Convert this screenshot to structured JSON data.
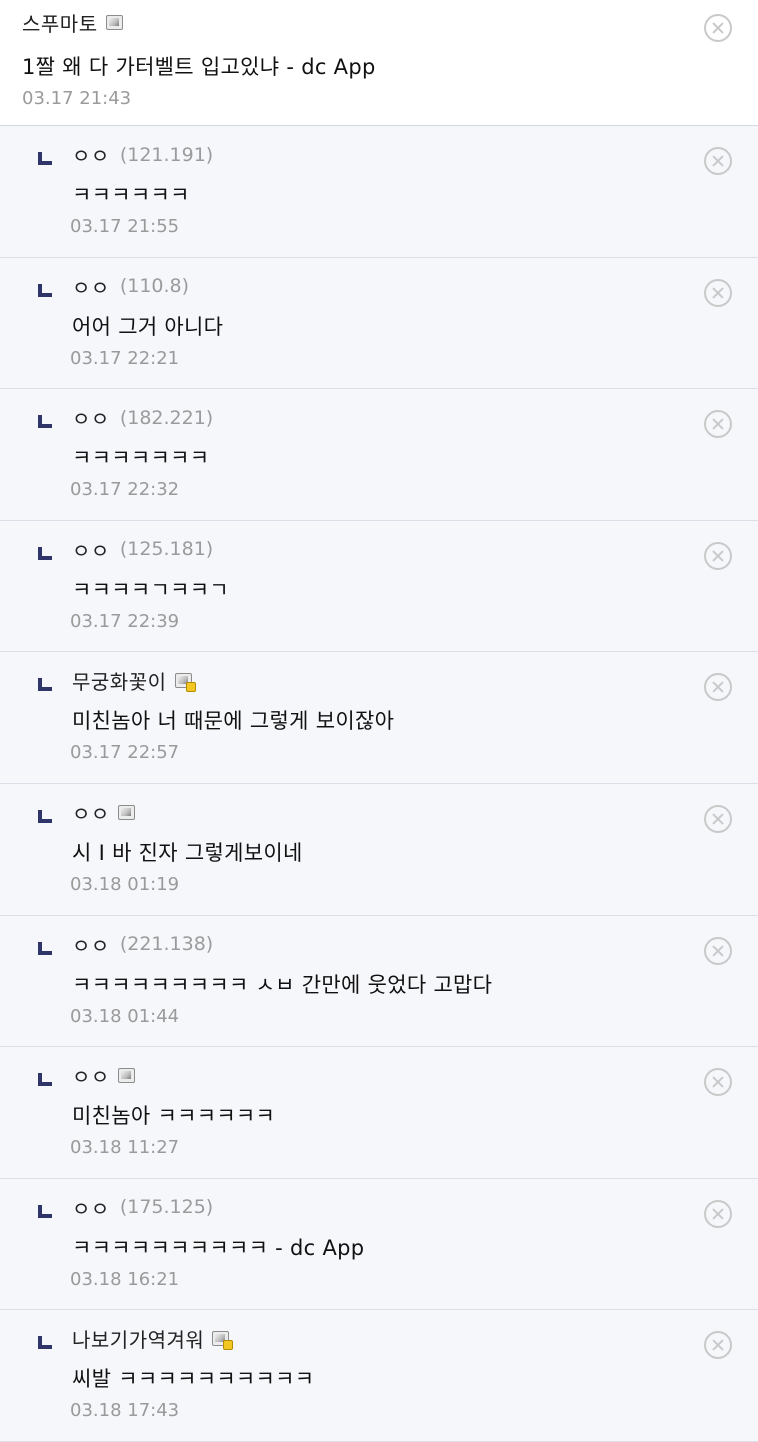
{
  "root_comment": {
    "nickname": "스푸마토",
    "icon": "gallog-icon",
    "text": "1짤 왜 다 가터벨트 입고있냐 - dc App",
    "date": "03.17 21:43"
  },
  "replies": [
    {
      "nickname": "ㅇㅇ",
      "ip": "(121.191)",
      "text": "ㅋㅋㅋㅋㅋㅋ",
      "date": "03.17 21:55"
    },
    {
      "nickname": "ㅇㅇ",
      "ip": "(110.8)",
      "text": "어어 그거 아니다",
      "date": "03.17 22:21"
    },
    {
      "nickname": "ㅇㅇ",
      "ip": "(182.221)",
      "text": "ㅋㅋㅋㅋㅋㅋㅋ",
      "date": "03.17 22:32"
    },
    {
      "nickname": "ㅇㅇ",
      "ip": "(125.181)",
      "text": "ㅋㅋㅋㅋㄱㅋㅋㄱ",
      "date": "03.17 22:39"
    },
    {
      "nickname": "무궁화꽃이",
      "icon": "gallog-half-icon",
      "text": "미친놈아 너 때문에 그렇게 보이잖아",
      "date": "03.17 22:57"
    },
    {
      "nickname": "ㅇㅇ",
      "icon": "gallog-icon",
      "text": "시 I 바 진자 그렇게보이네",
      "date": "03.18 01:19"
    },
    {
      "nickname": "ㅇㅇ",
      "ip": "(221.138)",
      "text": "ㅋㅋㅋㅋㅋㅋㅋㅋㅋ ㅅㅂ 간만에 웃었다 고맙다",
      "date": "03.18 01:44"
    },
    {
      "nickname": "ㅇㅇ",
      "icon": "gallog-icon",
      "text": "미친놈아 ㅋㅋㅋㅋㅋㅋ",
      "date": "03.18 11:27"
    },
    {
      "nickname": "ㅇㅇ",
      "ip": "(175.125)",
      "text": "ㅋㅋㅋㅋㅋㅋㅋㅋㅋㅋ - dc App",
      "date": "03.18 16:21"
    },
    {
      "nickname": "나보기가역겨워",
      "icon": "gallog-half-icon",
      "text": "씨발 ㅋㅋㅋㅋㅋㅋㅋㅋㅋㅋ",
      "date": "03.18 17:43"
    }
  ]
}
